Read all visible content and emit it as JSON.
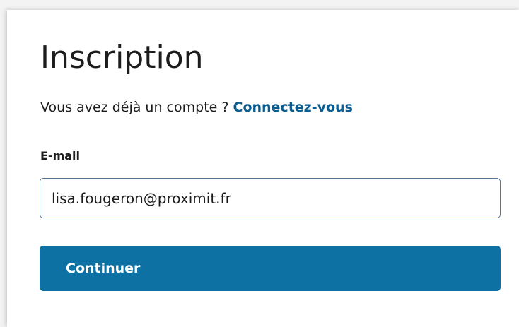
{
  "form": {
    "title": "Inscription",
    "account_prompt": "Vous avez déjà un compte ? ",
    "login_link": "Connectez-vous",
    "email_label": "E-mail",
    "email_value": "lisa.fougeron@proximit.fr",
    "continue_label": "Continuer"
  },
  "colors": {
    "link": "#0b5c8f",
    "button_bg": "#0d72a3",
    "button_text": "#ffffff",
    "input_border": "#5a7691",
    "text": "#1c1c1c"
  }
}
